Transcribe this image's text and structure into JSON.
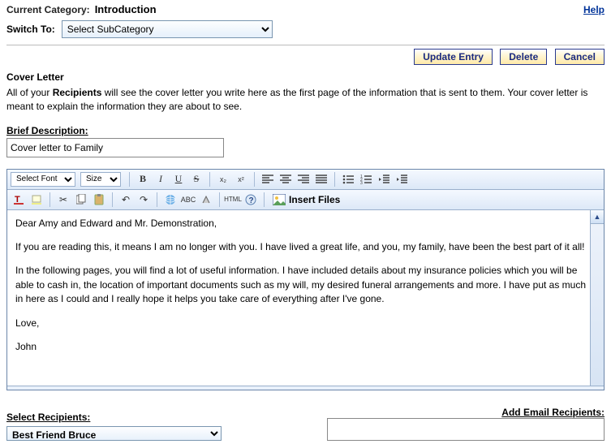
{
  "header": {
    "current_category_label": "Current Category:",
    "current_category_value": "Introduction",
    "help_label": "Help",
    "switch_to_label": "Switch To:",
    "subcategory_selected": "Select SubCategory"
  },
  "actions": {
    "update": "Update Entry",
    "delete": "Delete",
    "cancel": "Cancel"
  },
  "cover": {
    "title": "Cover Letter",
    "pre": "All of your ",
    "bold": "Recipients",
    "post": " will see the cover letter you write here as the first page of the information that is sent to them. Your cover letter is meant to explain the information they are about to see."
  },
  "brief": {
    "label": "Brief Description:",
    "value": "Cover letter to Family"
  },
  "toolbar": {
    "font_select": "Select Font",
    "size_select": "Size",
    "insert_files": "Insert Files",
    "html_label": "HTML"
  },
  "body": {
    "p1": "Dear Amy and Edward and Mr. Demonstration,",
    "p2": "If you are reading this, it means I am no longer with you. I have lived a great life, and you, my family, have been the best part of it all!",
    "p3": "In the following pages, you will find a lot of useful information. I have included details about my insurance policies which you will be able to cash in, the location of important documents such as my will, my desired funeral arrangements and more. I have put as much in here as I could and I really hope it helps you take care of everything after I've gone.",
    "p4": "Love,",
    "p5": "John"
  },
  "recipients": {
    "select_label": "Select Recipients:",
    "selected": "Best Friend Bruce",
    "add_label": "Add Email Recipients:"
  }
}
